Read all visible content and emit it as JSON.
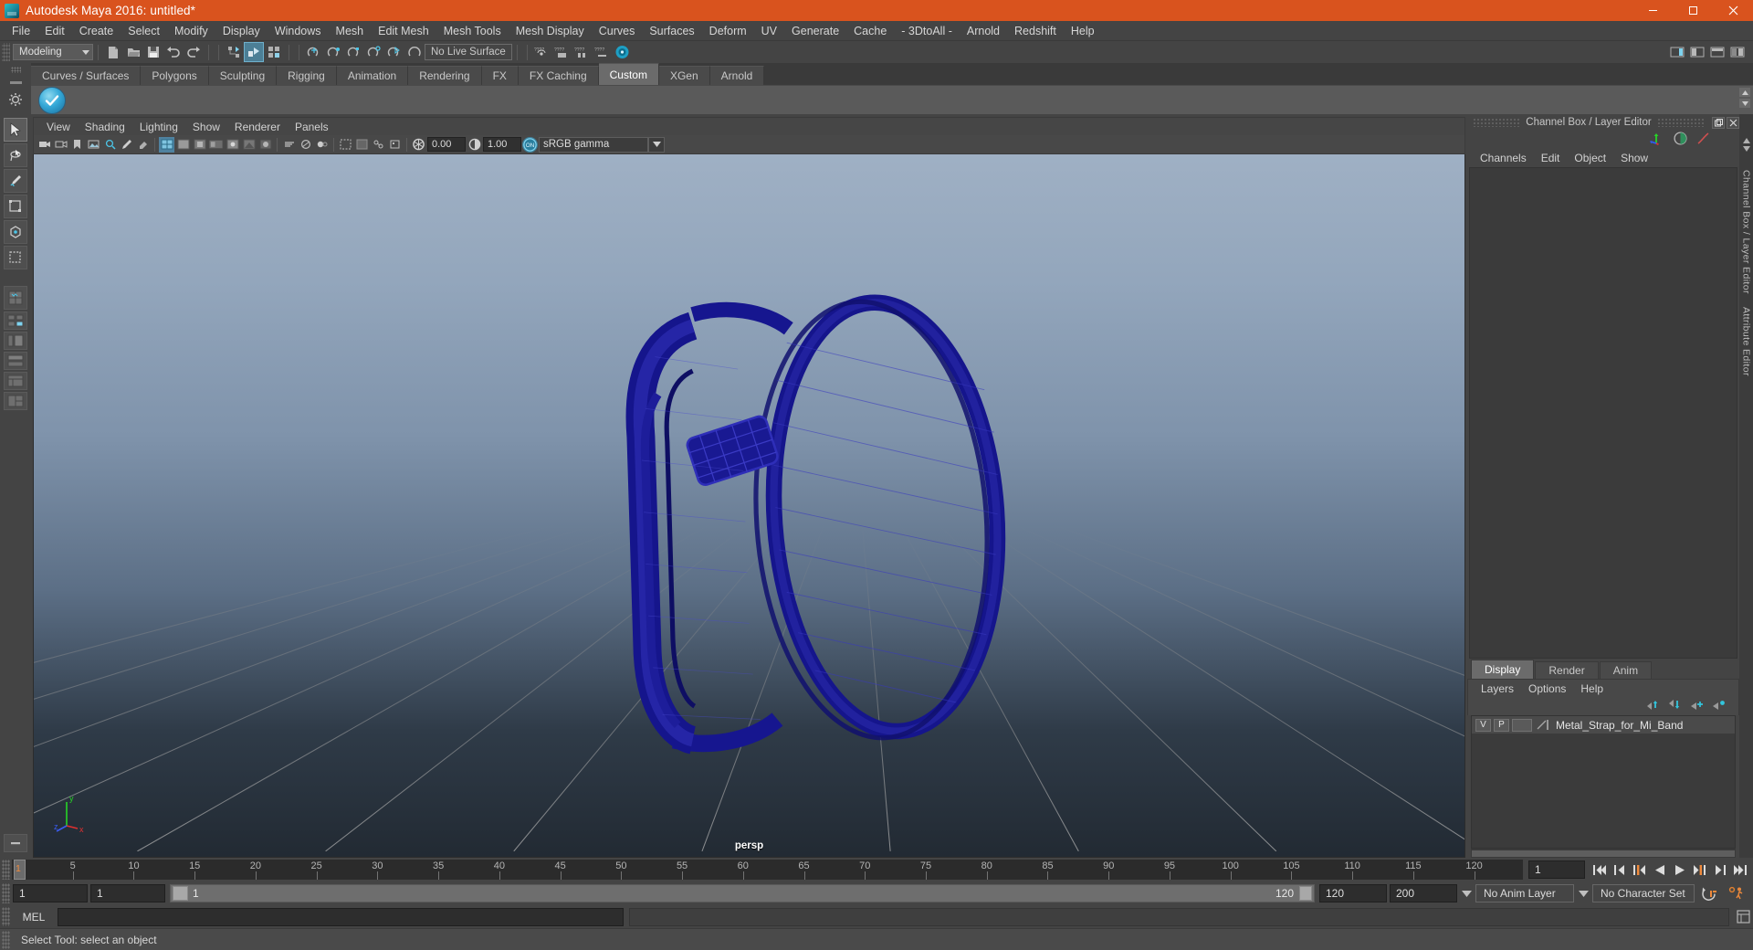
{
  "window": {
    "title": "Autodesk Maya 2016: untitled*",
    "minimize_label": "minimize",
    "maximize_label": "restore",
    "close_label": "close"
  },
  "menubar": {
    "items": [
      "File",
      "Edit",
      "Create",
      "Select",
      "Modify",
      "Display",
      "Windows",
      "Mesh",
      "Edit Mesh",
      "Mesh Tools",
      "Mesh Display",
      "Curves",
      "Surfaces",
      "Deform",
      "UV",
      "Generate",
      "Cache",
      "- 3DtoAll -",
      "Arnold",
      "Redshift",
      "Help"
    ]
  },
  "statusline": {
    "menuset": "Modeling",
    "live_surface": "No Live Surface",
    "snap_field_1": "",
    "snap_field_2": ""
  },
  "shelf": {
    "tabs": [
      "Curves / Surfaces",
      "Polygons",
      "Sculpting",
      "Rigging",
      "Animation",
      "Rendering",
      "FX",
      "FX Caching",
      "Custom",
      "XGen",
      "Arnold"
    ],
    "active_tab": "Custom",
    "item_icon": "3dtoall-shelf-icon"
  },
  "viewport": {
    "menus": [
      "View",
      "Shading",
      "Lighting",
      "Show",
      "Renderer",
      "Panels"
    ],
    "exposure_value": "0.00",
    "gamma_value": "1.00",
    "color_management_toggle": "ON",
    "color_profile": "sRGB gamma",
    "camera_label": "persp",
    "axis_labels": {
      "x": "x",
      "y": "y",
      "z": "z"
    },
    "model_color": "#1a1a8c",
    "bg_top": "#9fb0c4",
    "bg_bottom": "#222a33"
  },
  "channel_box": {
    "panel_title": "Channel Box / Layer Editor",
    "menus": [
      "Channels",
      "Edit",
      "Object",
      "Show"
    ],
    "icons": [
      "move-axis-icon",
      "sphere-shading-icon",
      "anim-curve-icon"
    ],
    "vertical_tabs": [
      "Channel Box / Layer Editor",
      "Attribute Editor"
    ]
  },
  "layer_editor": {
    "tabs": [
      "Display",
      "Render",
      "Anim"
    ],
    "active_tab": "Display",
    "menus": [
      "Layers",
      "Options",
      "Help"
    ],
    "toolbar_icons": [
      "move-layer-up-icon",
      "move-layer-down-icon",
      "new-layer-icon",
      "new-layer-from-selected-icon"
    ],
    "layers": [
      {
        "visibility": "V",
        "playback": "P",
        "state": "",
        "name": "Metal_Strap_for_Mi_Band"
      }
    ]
  },
  "time_slider": {
    "current_frame": "1",
    "current_frame_field": "1",
    "ticks": [
      5,
      10,
      15,
      20,
      25,
      30,
      35,
      40,
      45,
      50,
      55,
      60,
      65,
      70,
      75,
      80,
      85,
      90,
      95,
      100,
      105,
      110,
      115,
      120
    ],
    "end_marker": "120",
    "playback_buttons": [
      "go-to-start-icon",
      "step-back-keyframe-icon",
      "step-back-frame-icon",
      "play-backwards-icon",
      "play-forwards-icon",
      "step-forward-frame-icon",
      "step-forward-keyframe-icon",
      "go-to-end-icon"
    ]
  },
  "range_slider": {
    "anim_start": "1",
    "playback_start": "1",
    "range_start_label": "1",
    "range_end_label": "120",
    "playback_end": "120",
    "anim_end": "200",
    "anim_layer": "No Anim Layer",
    "character_set": "No Character Set",
    "auto_key_icon": "auto-keyframe-icon",
    "anim_prefs_icon": "animation-preferences-icon"
  },
  "command_line": {
    "language_label": "MEL",
    "input_value": "",
    "output_value": "",
    "script_editor_icon": "script-editor-icon"
  },
  "help_line": {
    "text": "Select Tool: select an object"
  },
  "toolbox": {
    "tools": [
      "select-tool",
      "lasso-select-tool",
      "paint-select-tool",
      "move-tool",
      "rotate-tool",
      "scale-tool",
      "last-tool-used",
      "show-manipulator-tool"
    ],
    "layout_buttons": [
      "single-perspective-layout",
      "four-view-layout",
      "outliner-persp-layout",
      "persp-graph-layout",
      "hypershade-persp-layout",
      "persp-two-stacked-layout",
      "shelf-layout-toggle"
    ]
  }
}
